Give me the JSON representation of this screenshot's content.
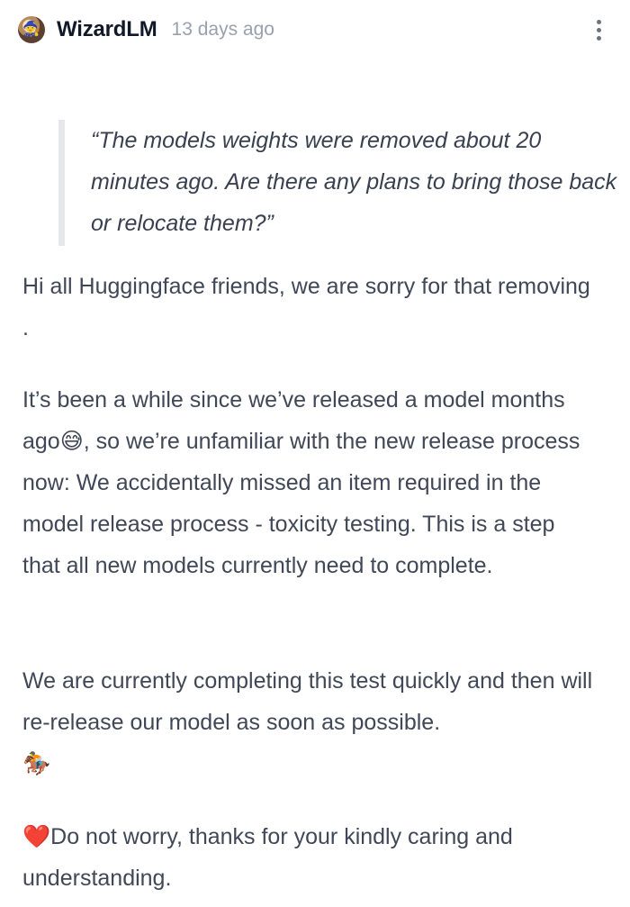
{
  "post": {
    "author": "WizardLM",
    "time_ago": "13 days ago",
    "avatar_emoji": "🧙",
    "more_icon": "more-vertical-icon",
    "quote": "“The models weights were removed about 20 minutes ago. Are there any plans to bring those back or relocate them?”",
    "paragraphs": {
      "p1": "Hi all Huggingface friends, we are sorry for that removing .",
      "p2_before": "It’s been a while since we’ve released a model months ago",
      "p2_emoji": "😅",
      "p2_after": ", so we’re unfamiliar with the new release process now: We accidentally missed an item required in the model release process - toxicity testing. This is a step that all new models currently need to complete.",
      "p3": "We are currently completing this test quickly and then will re-release our model as soon as possible.",
      "p3_emoji": "🏇",
      "p4_emoji": "❤️",
      "p4": "Do not worry, thanks for your kindly caring and understanding."
    }
  }
}
